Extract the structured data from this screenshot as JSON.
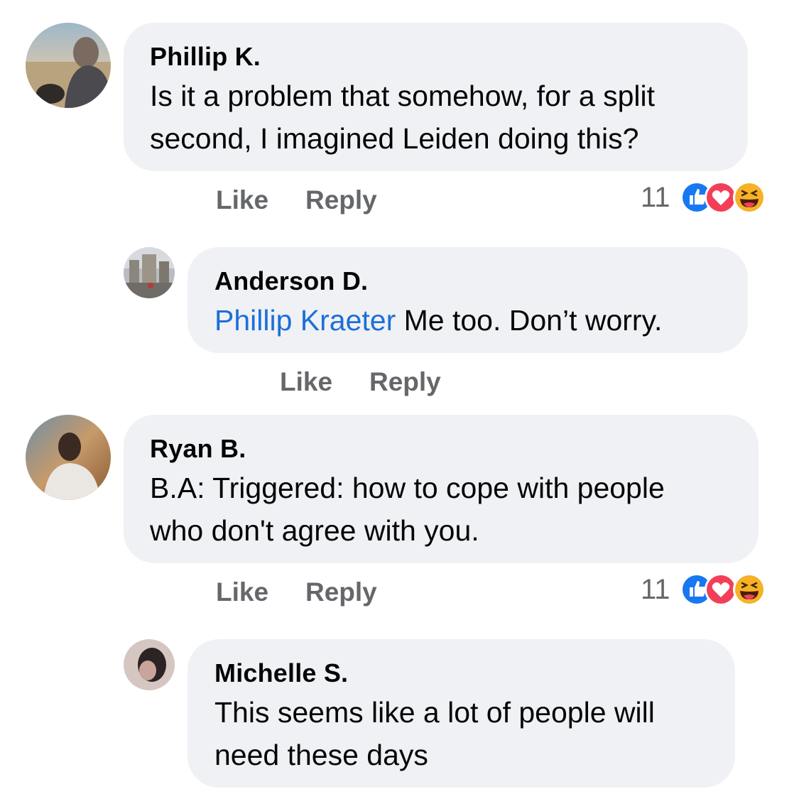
{
  "comments": [
    {
      "author": "Phillip K.",
      "lines": [
        "Is it a problem that somehow, for a split",
        "second, I imagined Leiden doing this?"
      ],
      "like_label": "Like",
      "reply_label": "Reply",
      "reaction_count": "11",
      "reactions": [
        "like-icon",
        "love-icon",
        "haha-icon"
      ]
    },
    {
      "author": "Anderson D.",
      "mention": "Phillip Kraeter",
      "text": " Me too. Don’t worry.",
      "like_label": "Like",
      "reply_label": "Reply"
    },
    {
      "author": "Ryan B.",
      "lines": [
        "B.A: Triggered: how to cope with people",
        "who don't agree with you."
      ],
      "like_label": "Like",
      "reply_label": "Reply",
      "reaction_count": "11",
      "reactions": [
        "like-icon",
        "love-icon",
        "haha-icon"
      ]
    },
    {
      "author": "Michelle S.",
      "lines": [
        "This seems like a lot of people will",
        "need these days"
      ]
    }
  ],
  "colors": {
    "bubble": "#f0f1f4",
    "mention": "#1c6fd8",
    "meta": "#65676b",
    "like": "#1877f2",
    "love": "#f33e58",
    "haha": "#f7b125"
  }
}
